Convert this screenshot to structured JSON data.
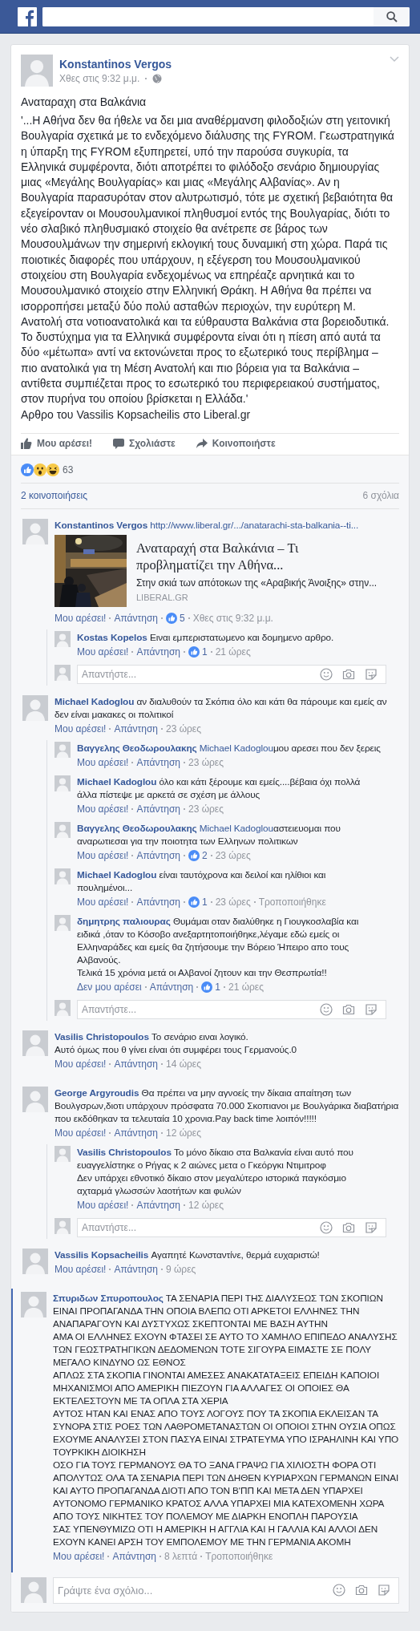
{
  "post": {
    "author": "Konstantinos Vergos",
    "time": "Χθες στις 9:32 μ.μ.",
    "title": "Αναταραχη στα Βαλκάνια",
    "body": "'...Η Αθήνα δεν θα ήθελε να δει μια αναθέρμανση φιλοδοξιών στη γειτονική Βουλγαρία σχετικά με το ενδεχόμενο διάλυσης της FYROM. Γεωστρατηγικά η ύπαρξη της FYROM εξυπηρετεί, υπό την παρούσα συγκυρία, τα Ελληνικά συμφέροντα, διότι αποτρέπει το φιλόδοξο σενάριο δημιουργίας μιας «Μεγάλης Βουλγαρίας» και μιας «Μεγάλης Αλβανίας». Αν η Βουλγαρία παρασυρόταν στον αλυτρωτισμό, τότε με σχετική βεβαιότητα θα εξεγείρονταν οι Μουσουλμανικοί πληθυσμοί εντός της Βουλγαρίας, διότι το νέο σλαβικό πληθυσμιακό στοιχείο θα ανέτρεπε σε βάρος των Μουσουλμάνων την σημερινή εκλογική τους δυναμική στη χώρα. Παρά τις ποιοτικές διαφορές που υπάρχουν, η εξέγερση του Μουσουλμανικού στοιχείου στη Βουλγαρία ενδεχομένως να επηρέαζε αρνητικά και το Μουσουλμανικό στοιχείο στην Ελληνική Θράκη. Η Αθήνα θα πρέπει να ισορροπήσει μεταξύ δύο πολύ ασταθών περιοχών, την ευρύτερη Μ. Ανατολή στα νοτιοανατολικά και τα εύθραυστα Βαλκάνια στα βορειοδυτικά. Το δυστύχημα για τα Ελληνικά συμφέροντα είναι ότι η πίεση από αυτά τα δύο «μέτωπα» αντί να εκτονώνεται προς το εξωτερικό τους περίβλημα – πιο ανατολικά για τη Μέση Ανατολή και πιο βόρεια για τα Βαλκάνια – αντίθετα συμπιέζεται προς το εσωτερικό του περιφερειακού συστήματος, στον πυρήνα του οποίου βρίσκεται η Ελλάδα.'",
    "source": "Αρθρο του Vassilis Kopsacheilis στο Liberal.gr"
  },
  "actions": [
    {
      "label": "Μου αρέσει!",
      "kind": "like"
    },
    {
      "label": "Σχολιάστε",
      "kind": "comment"
    },
    {
      "label": "Κοινοποιήστε",
      "kind": "share"
    }
  ],
  "reactions": {
    "count": "63"
  },
  "shares": "2 κοινοποιήσεις",
  "comment_count": "6 σχόλια",
  "comments": [
    {
      "author": "Konstantinos Vergos",
      "link": "http://www.liberal.gr/.../anatarachi-sta-balkania--ti...",
      "highlighted": false,
      "preview": {
        "title": "Αναταραχή στα Βαλκάνια – Τι προβληματίζει την Αθήνα...",
        "description": "Στην σκιά των απότοκων της «Αραβικής Άνοιξης» στην...",
        "domain": "LIBERAL.GR"
      },
      "meta": {
        "like": "Μου αρέσει!",
        "reply": "Απάντηση",
        "likes": "5",
        "time": "Χθες στις 9:32 μ.μ."
      },
      "replies": [
        {
          "author": "Kostas Kopelos",
          "text": "Eιναι εμπεριστατωμενο και δομημενο αρθρο.",
          "meta": {
            "like": "Μου αρέσει!",
            "reply": "Απάντηση",
            "likes": "1",
            "time": "21 ώρες"
          }
        }
      ],
      "reply_box": {
        "placeholder": "Απαντήστε..."
      }
    },
    {
      "author": "Michael Kadoglou",
      "text": "αν διαλυθούν τα Σκόπια όλο και κάτι θα πάρουμε και εμείς αν δεν είναι μακακες οι πολιτικοί",
      "highlighted": false,
      "meta": {
        "like": "Μου αρέσει!",
        "reply": "Απάντηση",
        "time": "23 ώρες"
      },
      "replies": [
        {
          "author": "Βαγγελης Θεοδωρουλακης",
          "mention": "Michael Kadoglou",
          "text": "μου αρεσει που δεν ξερεις",
          "meta": {
            "like": "Μου αρέσει!",
            "reply": "Απάντηση",
            "time": "23 ώρες"
          }
        },
        {
          "author": "Michael Kadoglou",
          "text": "όλο και κάτι ξέρουμε και εμείς....βέβαια όχι πολλά άλλα πίστεψε με αρκετά σε σχέση με άλλους",
          "meta": {
            "like": "Μου αρέσει!",
            "reply": "Απάντηση",
            "time": "23 ώρες"
          }
        },
        {
          "author": "Βαγγελης Θεοδωρουλακης",
          "mention": "Michael Kadoglou",
          "text": "αστειευομαι που αναρωτιεσαι για την ποιοτητα των Ελληνων πολιτικων",
          "meta": {
            "like": "Μου αρέσει!",
            "reply": "Απάντηση",
            "likes": "2",
            "time": "23 ώρες"
          }
        },
        {
          "author": "Michael Kadoglou",
          "text": "είναι ταυτόχρονα και δειλοί και ηλίθιοι και πουλημένοι...",
          "meta": {
            "like": "Μου αρέσει!",
            "reply": "Απάντηση",
            "likes": "1",
            "time": "23 ώρες",
            "edited": "Τροποποιήθηκε"
          }
        },
        {
          "author": "δημητρης παλιουρας",
          "text": "Θυμάμαι οταν διαλύθηκε η Γιουγκοσλαβία και ειδικά ,όταν το Κόσοβο ανεξαρτητοποιήθηκε,λέγαμε εδώ εμείς οι Ελληναράδες και εμείς θα ζητήσουμε την Βόρειο Ήπειρο απο τους Αλβανούς.\nΤελικά 15 χρόνια μετά οι Αλβανοί ζητουν και την Θεσπρωτία!!",
          "meta": {
            "like": "Δεν μου αρέσει",
            "reply": "Απάντηση",
            "likes": "1",
            "time": "21 ώρες"
          }
        }
      ],
      "reply_box": {
        "placeholder": "Απαντήστε..."
      }
    },
    {
      "author": "Vasilis Christopoulos",
      "text": "Το σενάριο ειναι λογικό.\nΑυτό όμως που θ γίνει είναι ότι συμφέρει τους Γερμανούς.0",
      "highlighted": false,
      "meta": {
        "like": "Μου αρέσει!",
        "reply": "Απάντηση",
        "time": "14 ώρες"
      }
    },
    {
      "author": "George Argyroudis",
      "text": "Θα πρέπει να μην αγνοείς την δίκαια απαίτηση των Βουλγσρων,διοτι υπάρχουν πρόσφατα 70.000 Σκοπιανοι με Βουλγάρικα διαβατήρια που εκδόθηκαν τα τελευταία 10 χρονια.Pay back time λοιπόν!!!!!",
      "highlighted": false,
      "meta": {
        "like": "Μου αρέσει!",
        "reply": "Απάντηση",
        "time": "12 ώρες"
      },
      "replies": [
        {
          "author": "Vasilis Christopoulos",
          "text": "Το μόνο δίκαιο στα Βαλκανία είναι αυτό που ευαγγελίστηκε ο Ρήγας κ 2 αιώνες μετα ο Γκεόργκι Ντιμιτροφ\nΔεν υπάρχει εθνοτικό δίκαιο στον μεγαλύτερο ιστορικά παγκόσμιο αχταρμά γλωσσών λαοτήτων και φυλών",
          "meta": {
            "like": "Μου αρέσει!",
            "reply": "Απάντηση",
            "time": "12 ώρες"
          }
        }
      ],
      "reply_box": {
        "placeholder": "Απαντήστε..."
      }
    },
    {
      "author": "Vassilis Kopsacheilis",
      "text": "Αγαπητέ Κωνσταντίνε, θερμά ευχαριστώ!",
      "highlighted": false,
      "meta": {
        "like": "Μου αρέσει!",
        "reply": "Απάντηση",
        "time": "9 ώρες"
      }
    },
    {
      "author": "Σπυριδων Σπυροπουλος",
      "text": "ΤΑ ΣΕΝΑΡΙΑ ΠΕΡΙ ΤΗΣ ΔΙΑΛΥΣΕΩΣ ΤΩΝ ΣΚΟΠΙΩΝ ΕΙΝΑΙ ΠΡΟΠΑΓΑΝΔΑ ΤΗΝ ΟΠΟΙΑ ΒΛΕΠΩ ΟΤΙ ΑΡΚΕΤΟΙ ΕΛΛΗΝΕΣ ΤΗΝ ΑΝΑΠΑΡΑΓΟΥΝ ΚΑΙ ΔΥΣΤΥΧΩΣ ΣΚΕΠΤΟΝΤΑΙ ΜΕ ΒΑΣΗ ΑΥΤΗΝ\nΑΜΑ ΟΙ ΕΛΛΗΝΕΣ ΕΧΟΥΝ ΦΤΑΣΕΙ ΣΕ ΑΥΤΟ ΤΟ ΧΑΜΗΛΟ ΕΠΙΠΕΔΟ ΑΝΑΛΥΣΗΣ ΤΩΝ ΓΕΩΣΤΡΑΤΗΓΙΚΩΝ ΔΕΔΟΜΕΝΩΝ ΤΟΤΕ ΣΙΓΟΥΡΑ ΕΙΜΑΣΤΕ ΣΕ ΠΟΛΥ ΜΕΓΑΛΟ ΚΙΝΔΥΝΟ ΩΣ ΕΘΝΟΣ\nΑΠΛΩΣ ΣΤΑ ΣΚΟΠΙΑ ΓΙΝΟΝΤΑΙ ΑΜΕΣΕΣ ΑΝΑΚΑΤΑΤΑΞΕΙΣ ΕΠΕΙΔΗ ΚΑΠΟΙΟΙ ΜΗΧΑΝΙΣΜΟΙ ΑΠΟ ΑΜΕΡΙΚΗ ΠΙΕΖΟΥΝ ΓΙΑ ΑΛΛΑΓΕΣ ΟΙ ΟΠΟΙΕΣ ΘΑ ΕΚΤΕΛΕΣΤΟΥΝ ΜΕ ΤΑ ΟΠΛΑ ΣΤΑ ΧΕΡΙΑ\nΑΥΤΟΣ ΗΤΑΝ ΚΑΙ ΕΝΑΣ ΑΠΟ ΤΟΥΣ ΛΟΓΟΥΣ ΠΟΥ ΤΑ ΣΚΟΠΙΑ ΕΚΛΕΙΣΑΝ ΤΑ ΣΥΝΟΡΑ ΣΤΙΣ ΡΟΕΣ ΤΩΝ ΛΑΘΡΟΜΕΤΑΝΑΣΤΩΝ ΟΙ ΟΠΟΙΟΙ ΣΤΗΝ ΟΥΣΙΑ ΟΠΩΣ ΕΧΟΥΜΕ ΑΝΑΛΥΣΕΙ ΣΤΟΝ ΠΑΣΥΑ ΕΙΝΑΙ ΣΤΡΑΤΕΥΜΑ ΥΠΟ ΙΣΡΑΗΛΙΝΗ ΚΑΙ ΥΠΟ ΤΟΥΡΚΙΚΗ ΔΙΟΙΚΗΣΗ\nΟΣΟ ΓΙΑ ΤΟΥΣ ΓΕΡΜΑΝΟΥΣ ΘΑ ΤΟ ΞΑΝΑ ΓΡΑΨΩ ΓΙΑ ΧΙΛΙΟΣΤΗ ΦΟΡΑ ΟΤΙ ΑΠΟΛΥΤΩΣ ΟΛΑ ΤΑ ΣΕΝΑΡΙΑ ΠΕΡΙ ΤΩΝ ΔΗΘΕΝ ΚΥΡΙΑΡΧΩΝ ΓΕΡΜΑΝΩΝ ΕΙΝΑΙ ΚΑΙ ΑΥΤΟ ΠΡΟΠΑΓΑΝΔΑ ΔΙΟΤΙ ΑΠΟ ΤΟΝ Β'ΠΠ ΚΑΙ ΜΕΤΑ ΔΕΝ ΥΠΑΡΧΕΙ ΑΥΤΟΝΟΜΟ ΓΕΡΜΑΝΙΚΟ ΚΡΑΤΟΣ ΑΛΛΑ ΥΠΑΡΧΕΙ ΜΙΑ ΚΑΤΕΧΟΜΕΝΗ ΧΩΡΑ ΑΠΟ ΤΟΥΣ ΝΙΚΗΤΕΣ ΤΟΥ ΠΟΛΕΜΟΥ ΜΕ ΔΙΑΡΚΗ ΕΝΟΠΛΗ ΠΑΡΟΥΣΙΑ\nΣΑΣ ΥΠΕΝΘΥΜΙΖΩ ΟΤΙ Η ΑΜΕΡΙΚΗ Η ΑΓΓΛΙΑ ΚΑΙ Η ΓΑΛΛΙΑ ΚΑΙ ΑΛΛΟΙ ΔΕΝ ΕΧΟΥΝ ΚΑΝΕΙ ΑΡΣΗ ΤΟΥ ΕΜΠΟΛΕΜΟΥ ΜΕ ΤΗΝ ΓΕΡΜΑΝΙΑ ΑΚΟΜΗ",
      "highlighted": true,
      "meta": {
        "like": "Μου αρέσει!",
        "reply": "Απάντηση",
        "time": "8 λεπτά",
        "edited": "Τροποποιήθηκε"
      }
    }
  ],
  "composer": {
    "placeholder": "Γράψτε ένα σχόλιο..."
  }
}
